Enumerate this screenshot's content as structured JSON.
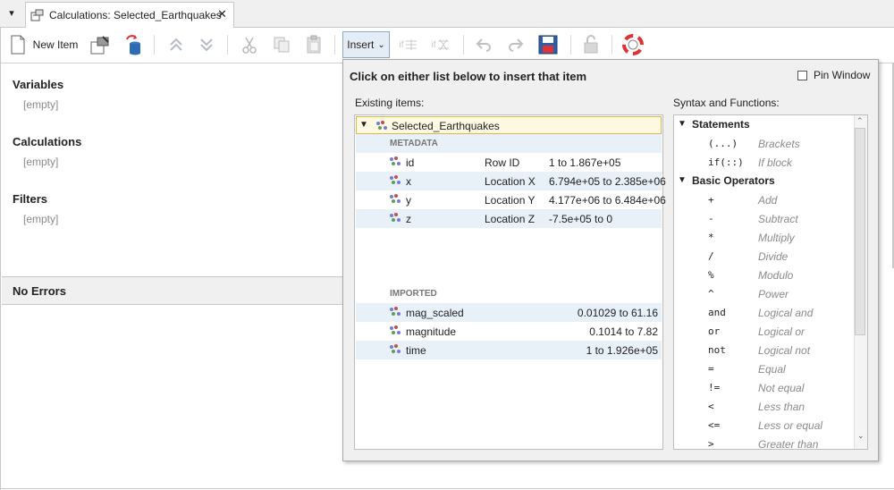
{
  "tab": {
    "label": "Calculations: Selected_Earthquakes",
    "close": "✕"
  },
  "toolbar": {
    "new_item_label": "New Item",
    "insert_label": "Insert",
    "if_label_1": "if",
    "if_label_2": "if"
  },
  "left": {
    "sections": [
      {
        "title": "Variables",
        "empty": "[empty]"
      },
      {
        "title": "Calculations",
        "empty": "[empty]"
      },
      {
        "title": "Filters",
        "empty": "[empty]"
      }
    ],
    "errors_title": "No Errors"
  },
  "popup": {
    "title": "Click on either list below to insert that item",
    "pin_label": "Pin Window",
    "existing_label": "Existing items:",
    "syntax_label": "Syntax and Functions:",
    "tree_root": "Selected_Earthquakes",
    "group_metadata": "METADATA",
    "group_imported": "IMPORTED",
    "metadata_items": [
      {
        "name": "id",
        "kind": "Row ID",
        "range": "1 to 1.867e+05"
      },
      {
        "name": "x",
        "kind": "Location X",
        "range": "6.794e+05 to 2.385e+06"
      },
      {
        "name": "y",
        "kind": "Location Y",
        "range": "4.177e+06 to 6.484e+06"
      },
      {
        "name": "z",
        "kind": "Location Z",
        "range": "-7.5e+05 to 0"
      }
    ],
    "imported_items": [
      {
        "name": "mag_scaled",
        "range": "0.01029 to 61.16"
      },
      {
        "name": "magnitude",
        "range": "0.1014 to 7.82"
      },
      {
        "name": "time",
        "range": "1 to 1.926e+05"
      }
    ],
    "statements_head": "Statements",
    "statements": [
      {
        "code": "(...)",
        "desc": "Brackets"
      },
      {
        "code": "if(::)",
        "desc": "If block"
      }
    ],
    "operators_head": "Basic Operators",
    "operators": [
      {
        "code": "+",
        "desc": "Add"
      },
      {
        "code": "-",
        "desc": "Subtract"
      },
      {
        "code": "*",
        "desc": "Multiply"
      },
      {
        "code": "/",
        "desc": "Divide"
      },
      {
        "code": "%",
        "desc": "Modulo"
      },
      {
        "code": "^",
        "desc": "Power"
      },
      {
        "code": "and",
        "desc": "Logical and"
      },
      {
        "code": "or",
        "desc": "Logical or"
      },
      {
        "code": "not",
        "desc": "Logical not"
      },
      {
        "code": "=",
        "desc": "Equal"
      },
      {
        "code": "!=",
        "desc": "Not equal"
      },
      {
        "code": "<",
        "desc": "Less than"
      },
      {
        "code": "<=",
        "desc": "Less or equal"
      },
      {
        "code": ">",
        "desc": "Greater than"
      }
    ]
  }
}
